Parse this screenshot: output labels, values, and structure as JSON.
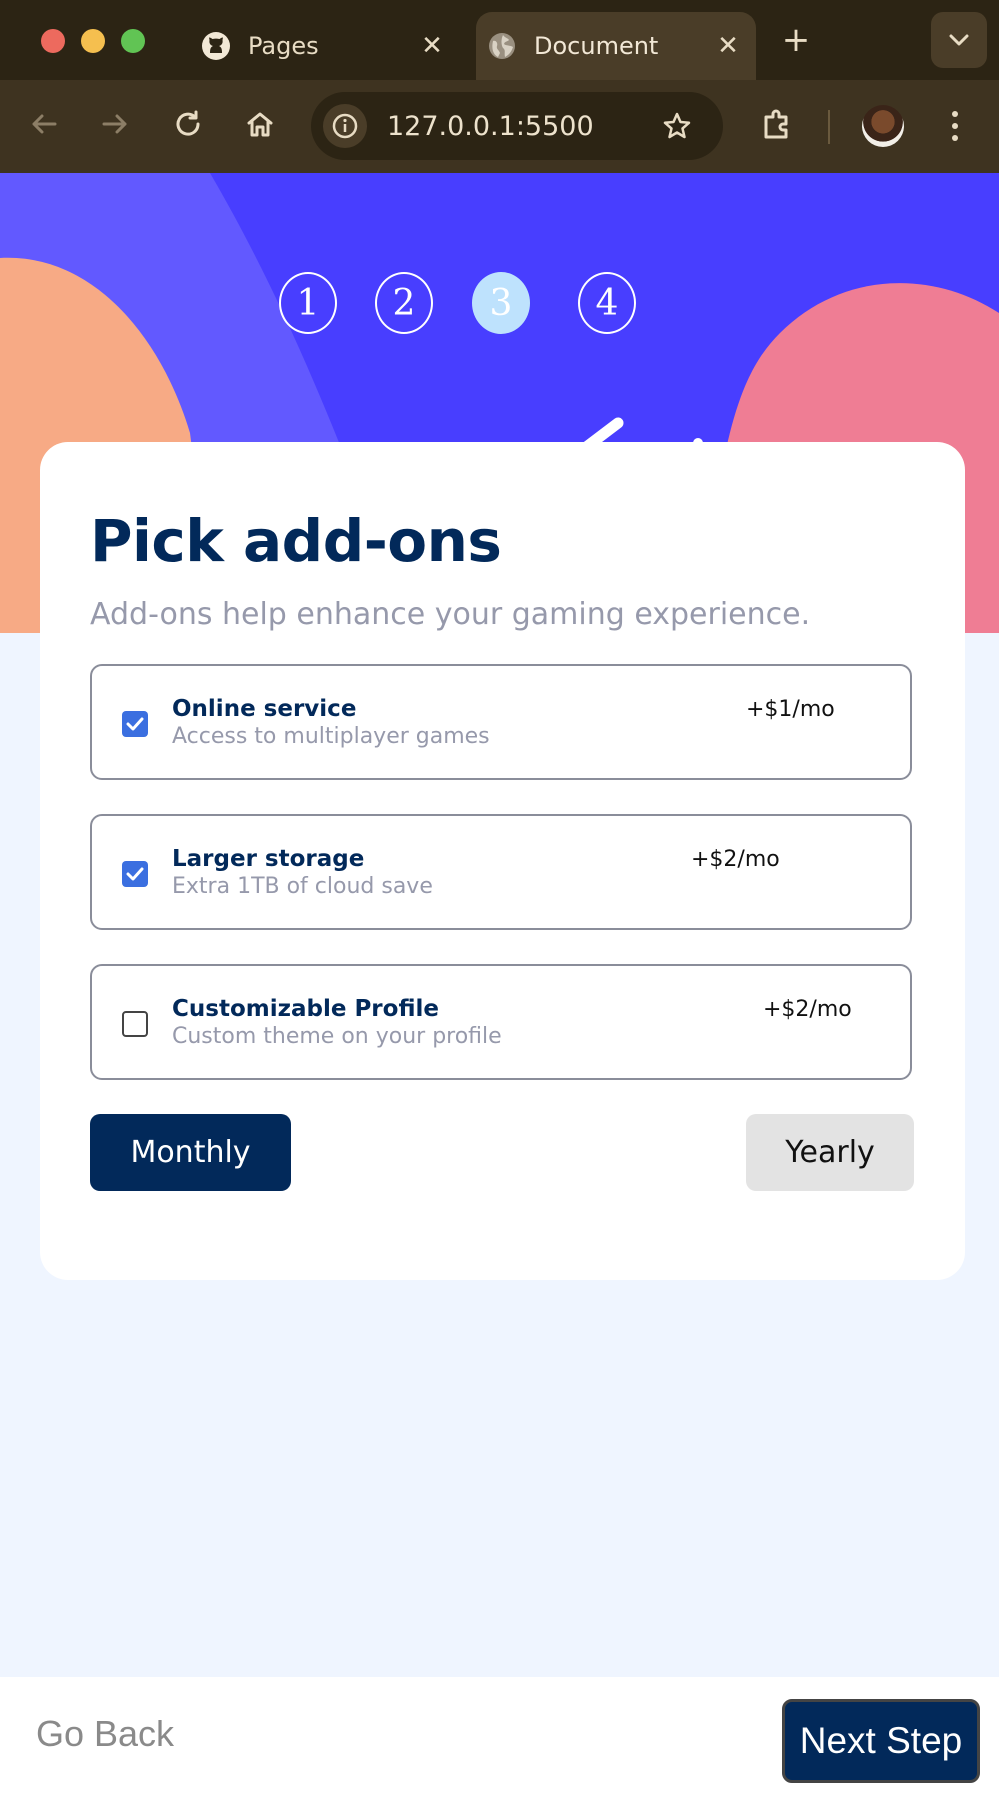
{
  "browser": {
    "tabs": [
      {
        "label": "Pages",
        "favicon": "github-icon"
      },
      {
        "label": "Document",
        "favicon": "globe-icon",
        "active": true
      }
    ],
    "address": "127.0.0.1:5500"
  },
  "steps": [
    "1",
    "2",
    "3",
    "4"
  ],
  "active_step": 3,
  "form": {
    "title": "Pick add-ons",
    "subtitle": "Add-ons help enhance your gaming experience.",
    "addons": [
      {
        "name": "Online service",
        "description": "Access to multiplayer games",
        "price": "+$1/mo",
        "checked": true
      },
      {
        "name": "Larger storage",
        "description": "Extra 1TB of cloud save",
        "price": "+$2/mo",
        "checked": true
      },
      {
        "name": "Customizable Profile",
        "description": "Custom theme on your profile",
        "price": "+$2/mo",
        "checked": false
      }
    ],
    "billing": {
      "monthly": "Monthly",
      "yearly": "Yearly",
      "selected": "Monthly"
    }
  },
  "footer": {
    "back": "Go Back",
    "next": "Next Step"
  },
  "colors": {
    "primary": "#483eff",
    "marine": "#02295a",
    "pastel_blue": "#bee2fd",
    "checkbox": "#3b6fe0",
    "page_bg": "#eff5ff"
  }
}
